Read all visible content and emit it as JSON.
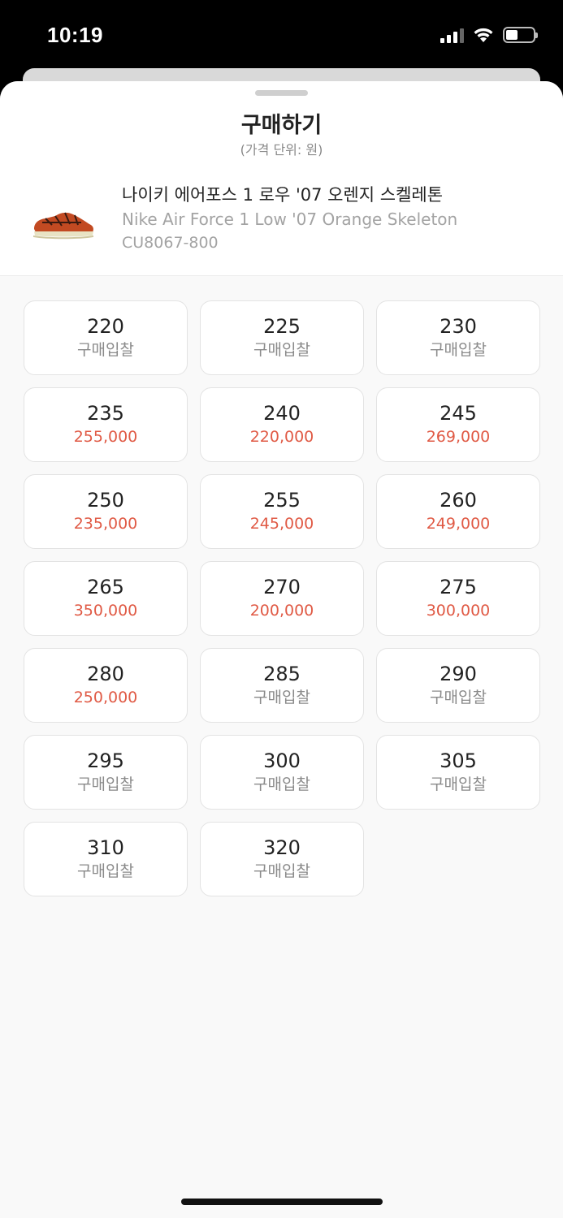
{
  "status_bar": {
    "time": "10:19"
  },
  "header": {
    "title": "구매하기",
    "subtitle": "(가격 단위: 원)"
  },
  "product": {
    "name_ko": "나이키 에어포스 1 로우 '07 오렌지 스켈레톤",
    "name_en": "Nike Air Force 1 Low '07 Orange Skeleton",
    "code": "CU8067-800",
    "image": "sneaker-image"
  },
  "colors": {
    "price_accent": "#e05a45",
    "muted": "#8a8a8a"
  },
  "sizes": [
    {
      "size": "220",
      "price": "구매입찰",
      "has_price": false
    },
    {
      "size": "225",
      "price": "구매입찰",
      "has_price": false
    },
    {
      "size": "230",
      "price": "구매입찰",
      "has_price": false
    },
    {
      "size": "235",
      "price": "255,000",
      "has_price": true
    },
    {
      "size": "240",
      "price": "220,000",
      "has_price": true
    },
    {
      "size": "245",
      "price": "269,000",
      "has_price": true
    },
    {
      "size": "250",
      "price": "235,000",
      "has_price": true
    },
    {
      "size": "255",
      "price": "245,000",
      "has_price": true
    },
    {
      "size": "260",
      "price": "249,000",
      "has_price": true
    },
    {
      "size": "265",
      "price": "350,000",
      "has_price": true
    },
    {
      "size": "270",
      "price": "200,000",
      "has_price": true
    },
    {
      "size": "275",
      "price": "300,000",
      "has_price": true
    },
    {
      "size": "280",
      "price": "250,000",
      "has_price": true
    },
    {
      "size": "285",
      "price": "구매입찰",
      "has_price": false
    },
    {
      "size": "290",
      "price": "구매입찰",
      "has_price": false
    },
    {
      "size": "295",
      "price": "구매입찰",
      "has_price": false
    },
    {
      "size": "300",
      "price": "구매입찰",
      "has_price": false
    },
    {
      "size": "305",
      "price": "구매입찰",
      "has_price": false
    },
    {
      "size": "310",
      "price": "구매입찰",
      "has_price": false
    },
    {
      "size": "320",
      "price": "구매입찰",
      "has_price": false
    }
  ]
}
